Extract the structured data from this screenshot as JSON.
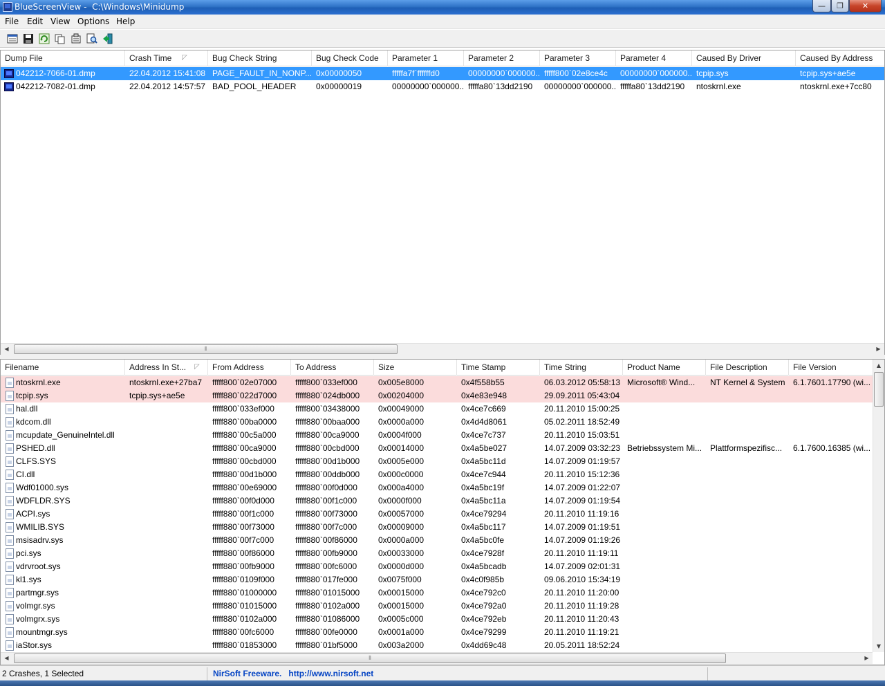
{
  "window": {
    "app_name": "BlueScreenView",
    "path": "C:\\Windows\\Minidump",
    "min_glyph": "—",
    "max_glyph": "❐",
    "close_glyph": "✕"
  },
  "menu": [
    "File",
    "Edit",
    "View",
    "Options",
    "Help"
  ],
  "toolbar": [
    "properties-icon",
    "save-icon",
    "refresh-icon",
    "copy-icon",
    "advanced-options-icon",
    "find-icon",
    "exit-icon"
  ],
  "dumps": {
    "columns": [
      "Dump File",
      "Crash Time",
      "Bug Check String",
      "Bug Check Code",
      "Parameter 1",
      "Parameter 2",
      "Parameter 3",
      "Parameter 4",
      "Caused By Driver",
      "Caused By Address"
    ],
    "sort_indicator": "◸",
    "rows": [
      [
        "042212-7066-01.dmp",
        "22.04.2012 15:41:08",
        "PAGE_FAULT_IN_NONP...",
        "0x00000050",
        "fffffa7f`ffffffd0",
        "00000000`000000...",
        "fffff800`02e8ce4c",
        "00000000`000000...",
        "tcpip.sys",
        "tcpip.sys+ae5e"
      ],
      [
        "042212-7082-01.dmp",
        "22.04.2012 14:57:57",
        "BAD_POOL_HEADER",
        "0x00000019",
        "00000000`000000...",
        "fffffa80`13dd2190",
        "00000000`000000...",
        "fffffa80`13dd2190",
        "ntoskrnl.exe",
        "ntoskrnl.exe+7cc80"
      ]
    ],
    "selected_index": 0
  },
  "drivers": {
    "columns": [
      "Filename",
      "Address In St...",
      "From Address",
      "To Address",
      "Size",
      "Time Stamp",
      "Time String",
      "Product Name",
      "File Description",
      "File Version"
    ],
    "sort_indicator": "◸",
    "rows": [
      [
        "ntoskrnl.exe",
        "ntoskrnl.exe+27ba7",
        "fffff800`02e07000",
        "fffff800`033ef000",
        "0x005e8000",
        "0x4f558b55",
        "06.03.2012 05:58:13",
        "Microsoft® Wind...",
        "NT Kernel & System",
        "6.1.7601.17790 (wi..."
      ],
      [
        "tcpip.sys",
        "tcpip.sys+ae5e",
        "fffff880`022d7000",
        "fffff880`024db000",
        "0x00204000",
        "0x4e83e948",
        "29.09.2011 05:43:04",
        "",
        "",
        ""
      ],
      [
        "hal.dll",
        "",
        "fffff800`033ef000",
        "fffff800`03438000",
        "0x00049000",
        "0x4ce7c669",
        "20.11.2010 15:00:25",
        "",
        "",
        ""
      ],
      [
        "kdcom.dll",
        "",
        "fffff880`00ba0000",
        "fffff880`00baa000",
        "0x0000a000",
        "0x4d4d8061",
        "05.02.2011 18:52:49",
        "",
        "",
        ""
      ],
      [
        "mcupdate_GenuineIntel.dll",
        "",
        "fffff880`00c5a000",
        "fffff880`00ca9000",
        "0x0004f000",
        "0x4ce7c737",
        "20.11.2010 15:03:51",
        "",
        "",
        ""
      ],
      [
        "PSHED.dll",
        "",
        "fffff880`00ca9000",
        "fffff880`00cbd000",
        "0x00014000",
        "0x4a5be027",
        "14.07.2009 03:32:23",
        "Betriebssystem Mi...",
        "Plattformspezifisc...",
        "6.1.7600.16385 (wi..."
      ],
      [
        "CLFS.SYS",
        "",
        "fffff880`00cbd000",
        "fffff880`00d1b000",
        "0x0005e000",
        "0x4a5bc11d",
        "14.07.2009 01:19:57",
        "",
        "",
        ""
      ],
      [
        "CI.dll",
        "",
        "fffff880`00d1b000",
        "fffff880`00ddb000",
        "0x000c0000",
        "0x4ce7c944",
        "20.11.2010 15:12:36",
        "",
        "",
        ""
      ],
      [
        "Wdf01000.sys",
        "",
        "fffff880`00e69000",
        "fffff880`00f0d000",
        "0x000a4000",
        "0x4a5bc19f",
        "14.07.2009 01:22:07",
        "",
        "",
        ""
      ],
      [
        "WDFLDR.SYS",
        "",
        "fffff880`00f0d000",
        "fffff880`00f1c000",
        "0x0000f000",
        "0x4a5bc11a",
        "14.07.2009 01:19:54",
        "",
        "",
        ""
      ],
      [
        "ACPI.sys",
        "",
        "fffff880`00f1c000",
        "fffff880`00f73000",
        "0x00057000",
        "0x4ce79294",
        "20.11.2010 11:19:16",
        "",
        "",
        ""
      ],
      [
        "WMILIB.SYS",
        "",
        "fffff880`00f73000",
        "fffff880`00f7c000",
        "0x00009000",
        "0x4a5bc117",
        "14.07.2009 01:19:51",
        "",
        "",
        ""
      ],
      [
        "msisadrv.sys",
        "",
        "fffff880`00f7c000",
        "fffff880`00f86000",
        "0x0000a000",
        "0x4a5bc0fe",
        "14.07.2009 01:19:26",
        "",
        "",
        ""
      ],
      [
        "pci.sys",
        "",
        "fffff880`00f86000",
        "fffff880`00fb9000",
        "0x00033000",
        "0x4ce7928f",
        "20.11.2010 11:19:11",
        "",
        "",
        ""
      ],
      [
        "vdrvroot.sys",
        "",
        "fffff880`00fb9000",
        "fffff880`00fc6000",
        "0x0000d000",
        "0x4a5bcadb",
        "14.07.2009 02:01:31",
        "",
        "",
        ""
      ],
      [
        "kl1.sys",
        "",
        "fffff880`0109f000",
        "fffff880`017fe000",
        "0x0075f000",
        "0x4c0f985b",
        "09.06.2010 15:34:19",
        "",
        "",
        ""
      ],
      [
        "partmgr.sys",
        "",
        "fffff880`01000000",
        "fffff880`01015000",
        "0x00015000",
        "0x4ce792c0",
        "20.11.2010 11:20:00",
        "",
        "",
        ""
      ],
      [
        "volmgr.sys",
        "",
        "fffff880`01015000",
        "fffff880`0102a000",
        "0x00015000",
        "0x4ce792a0",
        "20.11.2010 11:19:28",
        "",
        "",
        ""
      ],
      [
        "volmgrx.sys",
        "",
        "fffff880`0102a000",
        "fffff880`01086000",
        "0x0005c000",
        "0x4ce792eb",
        "20.11.2010 11:20:43",
        "",
        "",
        ""
      ],
      [
        "mountmgr.sys",
        "",
        "fffff880`00fc6000",
        "fffff880`00fe0000",
        "0x0001a000",
        "0x4ce79299",
        "20.11.2010 11:19:21",
        "",
        "",
        ""
      ],
      [
        "iaStor.sys",
        "",
        "fffff880`01853000",
        "fffff880`01bf5000",
        "0x003a2000",
        "0x4dd69c48",
        "20.05.2011 18:52:24",
        "",
        "",
        ""
      ]
    ],
    "highlighted_indices": [
      0,
      1
    ]
  },
  "status": {
    "summary": "2 Crashes, 1 Selected",
    "vendor": "NirSoft Freeware.",
    "url": "http://www.nirsoft.net"
  },
  "colors": {
    "selection": "#3399ff",
    "highlight_row": "#fbdcdc",
    "link": "#0645c4"
  }
}
